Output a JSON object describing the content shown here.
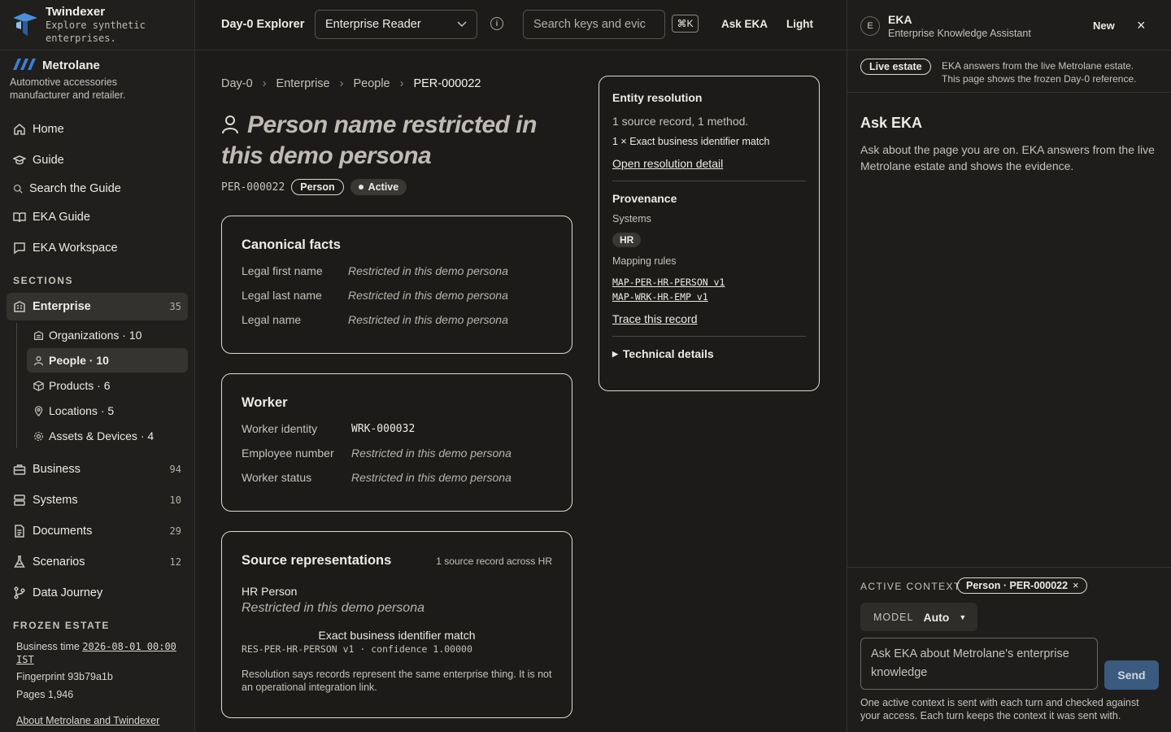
{
  "brand": {
    "name": "Twindexer",
    "tagline_1": "Explore synthetic",
    "tagline_2": "enterprises."
  },
  "org": {
    "name": "Metrolane",
    "desc_1": "Automotive accessories",
    "desc_2": "manufacturer and retailer."
  },
  "nav": {
    "home": "Home",
    "guide": "Guide",
    "search_guide": "Search the Guide",
    "eka_guide": "EKA Guide",
    "eka_workspace": "EKA Workspace",
    "sections_heading": "SECTIONS",
    "enterprise": {
      "label": "Enterprise",
      "count": "35"
    },
    "sub": {
      "organizations": "Organizations · 10",
      "people": "People · 10",
      "products": "Products · 6",
      "locations": "Locations · 5",
      "assets": "Assets & Devices · 4"
    },
    "business": {
      "label": "Business",
      "count": "94"
    },
    "systems": {
      "label": "Systems",
      "count": "10"
    },
    "documents": {
      "label": "Documents",
      "count": "29"
    },
    "scenarios": {
      "label": "Scenarios",
      "count": "12"
    },
    "data_journey": "Data Journey"
  },
  "frozen": {
    "heading": "FROZEN ESTATE",
    "business_time_label": "Business time",
    "business_time_value": "2026-08-01 00:00",
    "business_time_tz": "IST",
    "fingerprint": "Fingerprint 93b79a1b",
    "pages": "Pages 1,946",
    "about": "About Metrolane and Twindexer"
  },
  "topbar": {
    "title": "Day-0 Explorer",
    "role": "Enterprise Reader",
    "search_placeholder": "Search keys and evic",
    "kbd": "⌘K",
    "ask": "Ask EKA",
    "theme": "Light"
  },
  "breadcrumb": [
    "Day-0",
    "Enterprise",
    "People",
    "PER-000022"
  ],
  "entity": {
    "title": "Person name restricted in this demo persona",
    "id": "PER-000022",
    "type": "Person",
    "status": "Active"
  },
  "canonical": {
    "heading": "Canonical facts",
    "rows": [
      {
        "k": "Legal first name",
        "v": "Restricted in this demo persona"
      },
      {
        "k": "Legal last name",
        "v": "Restricted in this demo persona"
      },
      {
        "k": "Legal name",
        "v": "Restricted in this demo persona"
      }
    ]
  },
  "worker": {
    "heading": "Worker",
    "identity_label": "Worker identity",
    "identity_value": "WRK-000032",
    "employee_label": "Employee number",
    "employee_value": "Restricted in this demo persona",
    "status_label": "Worker status",
    "status_value": "Restricted in this demo persona"
  },
  "source": {
    "heading": "Source representations",
    "summary": "1 source record across HR",
    "system_name": "HR Person",
    "value": "Restricted in this demo persona",
    "match": "Exact business identifier match",
    "detail": "RES-PER-HR-PERSON v1 · confidence 1.00000",
    "note": "Resolution says records represent the same enterprise thing. It is not an operational integration link."
  },
  "resolution": {
    "heading": "Entity resolution",
    "summary": "1 source record, 1 method.",
    "method": "1 × Exact business identifier match",
    "link": "Open resolution detail"
  },
  "provenance": {
    "heading": "Provenance",
    "systems_label": "Systems",
    "system": "HR",
    "rules_label": "Mapping rules",
    "rules": [
      "MAP-PER-HR-PERSON v1",
      "MAP-WRK-HR-EMP v1"
    ],
    "trace": "Trace this record",
    "technical": "Technical details"
  },
  "eka": {
    "avatar": "E",
    "name": "EKA",
    "subtitle": "Enterprise Knowledge Assistant",
    "new": "New",
    "badge": "Live estate",
    "notice_1": "EKA answers from the live Metrolane estate.",
    "notice_2": "This page shows the frozen Day-0 reference.",
    "heading": "Ask EKA",
    "intro": "Ask about the page you are on. EKA answers from the live Metrolane estate and shows the evidence.",
    "context_label": "ACTIVE CONTEXT",
    "context_value": "Person · PER-000022",
    "model_label": "MODEL",
    "model_value": "Auto",
    "input_placeholder": "Ask EKA about Metrolane's enterprise knowledge",
    "send": "Send",
    "footnote": "One active context is sent with each turn and checked against your access. Each turn keeps the context it was sent with."
  },
  "colors": {
    "background": "#1c1b19",
    "panel": "#201f1d",
    "send": "#3a5a7e",
    "text": "#ecebe6"
  }
}
